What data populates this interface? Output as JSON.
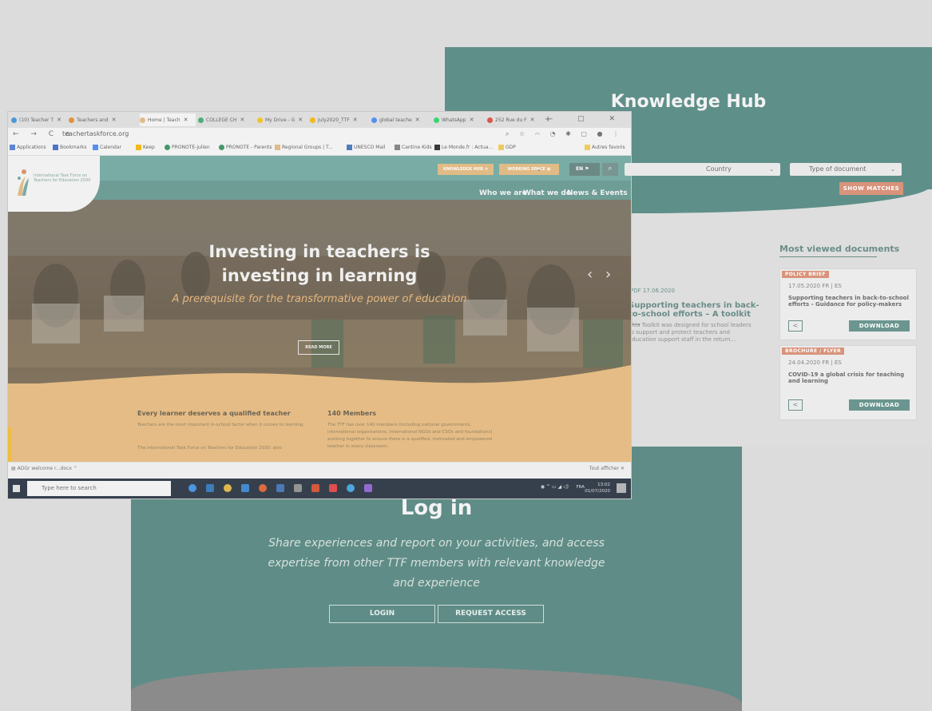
{
  "knowledge_hub": {
    "title": "Knowledge Hub",
    "country": "Country",
    "type_of_document": "Type of document",
    "show_matches": "SHOW MATCHES",
    "most_viewed": "Most viewed documents",
    "doc": {
      "meta": "PDF  17.06.2020",
      "title": "Supporting teachers in back-to-school efforts – A toolkit f...",
      "desc": "This Toolkit was designed for school leaders to support and protect teachers and education support staff in the return..."
    },
    "cards": [
      {
        "tag": "POLICY BRIEF",
        "meta": "17.05.2020   FR | ES",
        "title": "Supporting teachers in back-to-school efforts - Guidance for policy-makers",
        "download": "DOWNLOAD"
      },
      {
        "tag": "BROCHURE / FLYER",
        "meta": "24.04.2020   FR | ES",
        "title": "COVID-19 a global crisis for teaching and learning",
        "download": "DOWNLOAD"
      }
    ]
  },
  "login": {
    "title": "Log in",
    "desc": "Share experiences and report on your activities, and access expertise from other TTF members with relevant knowledge and experience",
    "login_btn": "LOGIN",
    "request_btn": "REQUEST ACCESS"
  },
  "browser": {
    "tabs": [
      {
        "label": "(10) Teacher T",
        "color": "#3b8ed6"
      },
      {
        "label": "Teachers and",
        "color": "#e08a2a"
      },
      {
        "label": "Home | Teach",
        "color": "#e2b77a"
      },
      {
        "label": "COLLEGE CH",
        "color": "#3aa56a"
      },
      {
        "label": "My Drive - G",
        "color": "#f4c20d"
      },
      {
        "label": "July2020_TTF",
        "color": "#f4b400"
      },
      {
        "label": "global teache",
        "color": "#4285f4"
      },
      {
        "label": "WhatsApp",
        "color": "#25d366"
      },
      {
        "label": "252 Rue du F",
        "color": "#db4437"
      }
    ],
    "new_tab": "+",
    "window_controls": "–  ▢  ✕",
    "nav": "← → C ⌂",
    "url": "teachertaskforce.org",
    "bookmarks": [
      {
        "label": "Applications",
        "color": "#4a7bd0"
      },
      {
        "label": "Bookmarks",
        "color": "#3b66c4"
      },
      {
        "label": "Calendar",
        "color": "#4285f4"
      },
      {
        "label": "Keep",
        "color": "#f4b400"
      },
      {
        "label": "PRONOTE-julien",
        "color": "#2f8f5a"
      },
      {
        "label": "PRONOTE - Parents",
        "color": "#2f8f5a"
      },
      {
        "label": "Regional Groups | T...",
        "color": "#e2b77a"
      },
      {
        "label": "UNESCO Mail",
        "color": "#3d6fb5"
      },
      {
        "label": "Cantine Kids",
        "color": "#7c7c7c"
      },
      {
        "label": "Le Monde.fr : Actua...",
        "color": "#222222"
      },
      {
        "label": "GDP",
        "color": "#f2c94c"
      },
      {
        "label": "Autres favoris",
        "color": "#f2c94c"
      }
    ],
    "download": "ADGr welcome r...docx",
    "show_all": "Tout afficher",
    "taskbar_search": "Type here to search",
    "taskbar_lang": "FRA",
    "clock_time": "13:02",
    "clock_date": "01/07/2020"
  },
  "site": {
    "logo_text": "International Task Force on Teachers for Education 2030",
    "knowledge_hub": "KNOWLEDGE HUB",
    "working_space": "WORKING SPACE",
    "lang": "EN",
    "nav": [
      "Who we are",
      "What we do",
      "News & Events"
    ],
    "hero_title": "Investing in teachers is investing in learning",
    "hero_sub": "A prerequisite for the transformative power of education",
    "read_more": "READ MORE",
    "col1_title": "Every learner deserves a qualified teacher",
    "col1_p1": "Teachers are the most important in-school factor when it comes to learning.",
    "col1_p2": "The International Task Force on Teachers for Education 2030, also",
    "col2_title": "140 Members",
    "col2_p1": "The TTF has over 140 members (including national governments, international organisations, international NGOs and CSOs and foundations) working together to ensure there is a qualified, motivated and empowered teacher in every classroom."
  }
}
